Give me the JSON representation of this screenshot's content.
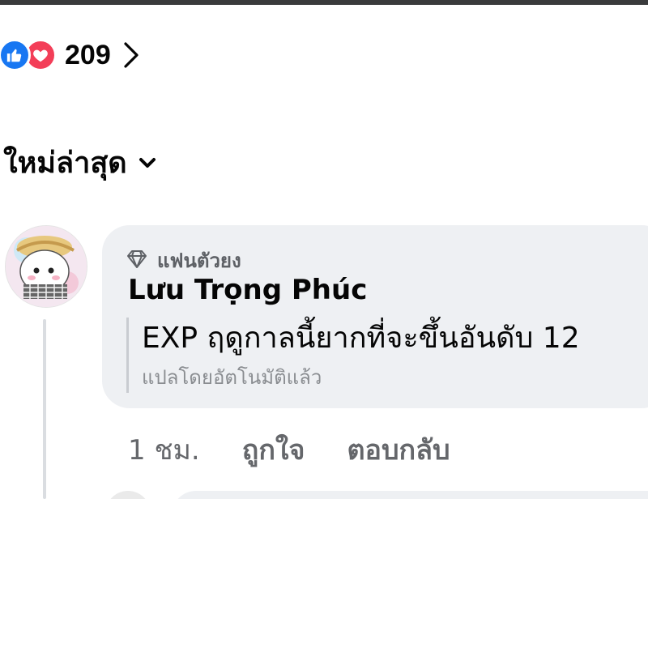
{
  "reactions": {
    "icons": [
      "like-icon",
      "love-icon"
    ],
    "count": "209"
  },
  "sort": {
    "label": "ใหม่ล่าสุด"
  },
  "comment": {
    "badge_icon": "diamond-icon",
    "badge_label": "แฟนตัวยง",
    "author": "Lưu Trọng Phúc",
    "text": "EXP ฤดูกาลนี้ยากที่จะขึ้นอันดับ 12",
    "translation_note": "แปลโดยอัตโนมัติแล้ว",
    "time": "1 ชม.",
    "like_label": "ถูกใจ",
    "reply_label": "ตอบกลับ"
  },
  "colors": {
    "like_blue": "#1877f2",
    "love_red": "#f33e58",
    "bubble_bg": "#eef0f3",
    "secondary_text": "#65676b"
  }
}
